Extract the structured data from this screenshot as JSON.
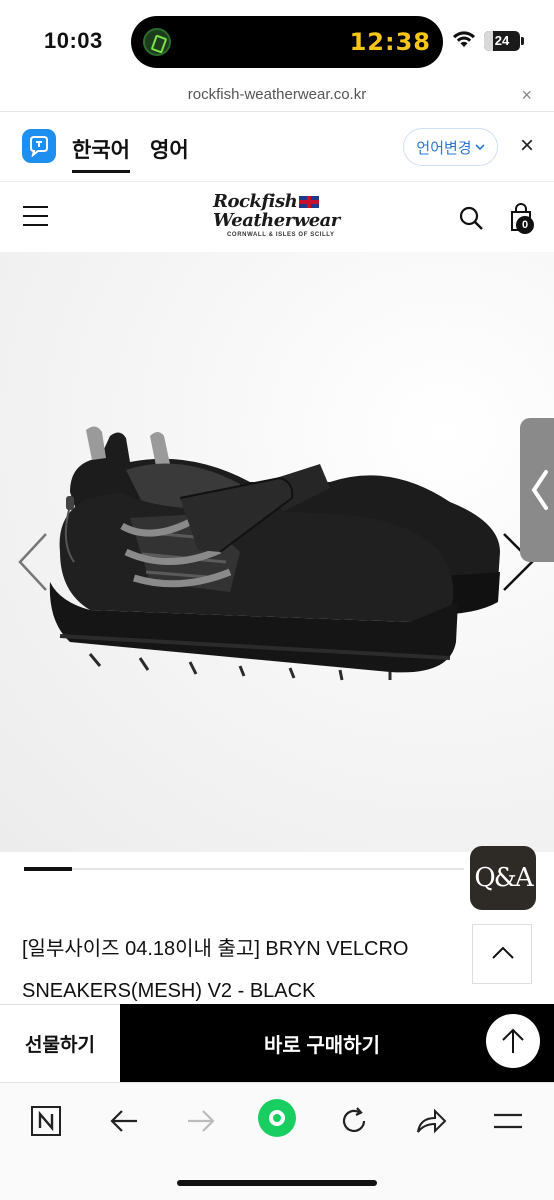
{
  "status_bar": {
    "time": "10:03",
    "island_timer": "12:38",
    "battery": "24",
    "battery_level": 0.24,
    "icons": [
      "app-activity-icon",
      "wifi-icon",
      "battery-icon"
    ]
  },
  "url_bar": {
    "url": "rockfish-weatherwear.co.kr",
    "close": "×"
  },
  "translate_bar": {
    "app_icon": "papago-translate-icon",
    "tabs": [
      {
        "label": "한국어",
        "active": true
      },
      {
        "label": "영어",
        "active": false
      }
    ],
    "change_label": "언어변경",
    "close": "×",
    "accent_color": "#2a78d6"
  },
  "header": {
    "logo_line1": "Rockfish",
    "logo_line2": "Weatherwear",
    "logo_sub": "CORNWALL & ISLES OF SCILLY",
    "cart_count": "0",
    "icons": [
      "menu-icon",
      "search-icon",
      "cart-icon"
    ]
  },
  "gallery": {
    "image_alt": "black velcro mesh sneakers",
    "slide_progress": 0.11,
    "icons": [
      "chevron-left-icon",
      "chevron-right-icon",
      "side-panel-chevron-icon"
    ]
  },
  "qa_button": {
    "label": "Q&A"
  },
  "product": {
    "title_line1": "[일부사이즈 04.18이내 출고] BRYN VELCRO",
    "title_line2": "SNEAKERS(MESH) V2 - BLACK"
  },
  "actions": {
    "gift_label": "선물하기",
    "buy_label": "바로 구매하기",
    "top_icon": "arrow-up-icon"
  },
  "browser_toolbar": {
    "items": [
      "naver-n-icon",
      "back-arrow-icon",
      "forward-arrow-icon",
      "green-dot-icon",
      "reload-icon",
      "share-icon",
      "menu-lines-icon"
    ],
    "accent_color": "#19ce60"
  }
}
